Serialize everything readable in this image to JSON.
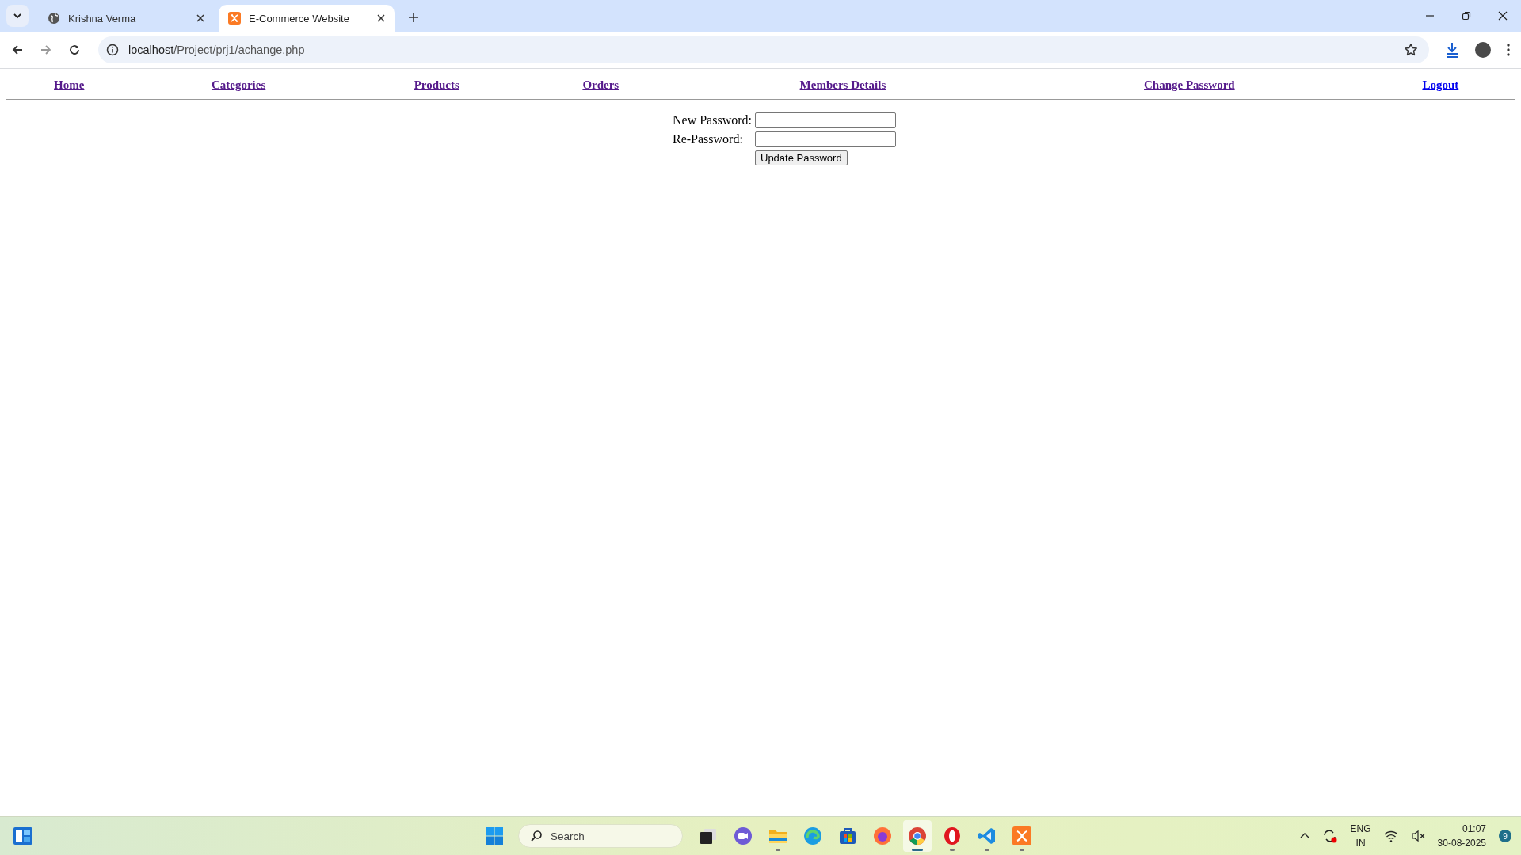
{
  "browser": {
    "tabs": [
      {
        "title": "Krishna Verma",
        "kind": "globe",
        "selected": false
      },
      {
        "title": "E-Commerce Website",
        "kind": "xampp",
        "selected": true
      }
    ],
    "address": {
      "host": "localhost",
      "path": "/Project/prj1/achange.php"
    }
  },
  "nav": [
    {
      "label": "Home",
      "visited": true
    },
    {
      "label": "Categories",
      "visited": true
    },
    {
      "label": "Products",
      "visited": true
    },
    {
      "label": "Orders",
      "visited": true
    },
    {
      "label": "Members Details",
      "visited": true
    },
    {
      "label": "Change Password",
      "visited": true
    },
    {
      "label": "Logout",
      "visited": false
    }
  ],
  "form": {
    "fields": [
      {
        "label": "New Password:"
      },
      {
        "label": "Re-Password:"
      }
    ],
    "button": "Update Password"
  },
  "taskbar": {
    "search": {
      "placeholder": "Search"
    },
    "apps": [
      {
        "kind": "taskview",
        "running": false,
        "active": false
      },
      {
        "kind": "meet",
        "running": false,
        "active": false
      },
      {
        "kind": "folder",
        "running": true,
        "active": false
      },
      {
        "kind": "edge",
        "running": false,
        "active": false
      },
      {
        "kind": "store",
        "running": false,
        "active": false
      },
      {
        "kind": "firefox",
        "running": false,
        "active": false
      },
      {
        "kind": "chrome",
        "running": true,
        "active": true
      },
      {
        "kind": "opera",
        "running": true,
        "active": false
      },
      {
        "kind": "vscode",
        "running": true,
        "active": false
      },
      {
        "kind": "xampp",
        "running": true,
        "active": false
      }
    ],
    "tray": {
      "language": "ENG",
      "region": "IN",
      "time": "01:07",
      "date": "30-08-2025",
      "notifications": "9"
    }
  }
}
